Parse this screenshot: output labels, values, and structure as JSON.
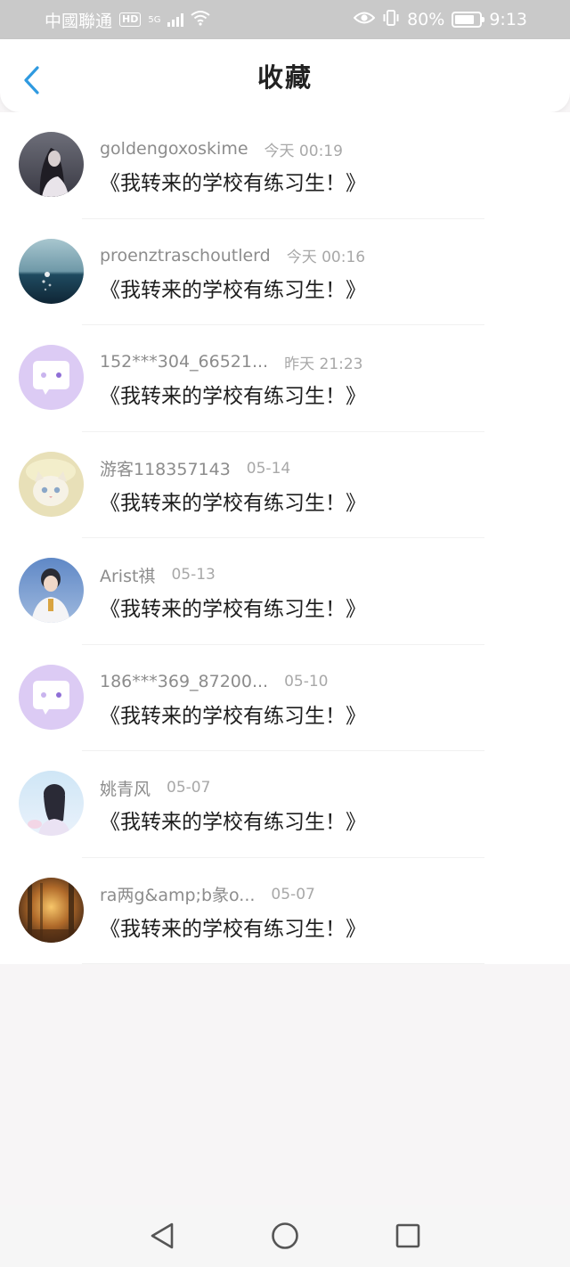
{
  "status_bar": {
    "carrier": "中國聯通",
    "hd": "HD",
    "network": "5G",
    "battery": "80%",
    "battery_level": 0.8,
    "time": "9:13"
  },
  "header": {
    "title": "收藏",
    "back_icon": "chevron-left-icon"
  },
  "favorites": [
    {
      "author": "goldengoxoskime",
      "time": "今天 00:19",
      "title": "《我转来的学校有练习生！》",
      "avatar": "dark-portrait"
    },
    {
      "author": "proenztraschoutlerd",
      "time": "今天 00:16",
      "title": "《我转来的学校有练习生！》",
      "avatar": "ocean-sun"
    },
    {
      "author": "152***304_66521...",
      "time": "昨天 21:23",
      "title": "《我转来的学校有练习生！》",
      "avatar": "default-chat"
    },
    {
      "author": "游客118357143",
      "time": "05-14",
      "title": "《我转来的学校有练习生！》",
      "avatar": "cat"
    },
    {
      "author": "Arist祺",
      "time": "05-13",
      "title": "《我转来的学校有练习生！》",
      "avatar": "blue-portrait"
    },
    {
      "author": "186***369_87200...",
      "time": "05-10",
      "title": "《我转来的学校有练习生！》",
      "avatar": "default-chat"
    },
    {
      "author": "姚青风",
      "time": "05-07",
      "title": "《我转来的学校有练习生！》",
      "avatar": "anime-girl"
    },
    {
      "author": "ra两g&amp;b彖o...",
      "time": "05-07",
      "title": "《我转来的学校有练习生！》",
      "avatar": "forest-sunset"
    }
  ],
  "colors": {
    "accent": "#2f9ae0",
    "default_avatar_bg": "#dccbf4"
  },
  "nav": {
    "back_icon": "triangle-back-icon",
    "home_icon": "circle-home-icon",
    "recents_icon": "square-recents-icon"
  }
}
